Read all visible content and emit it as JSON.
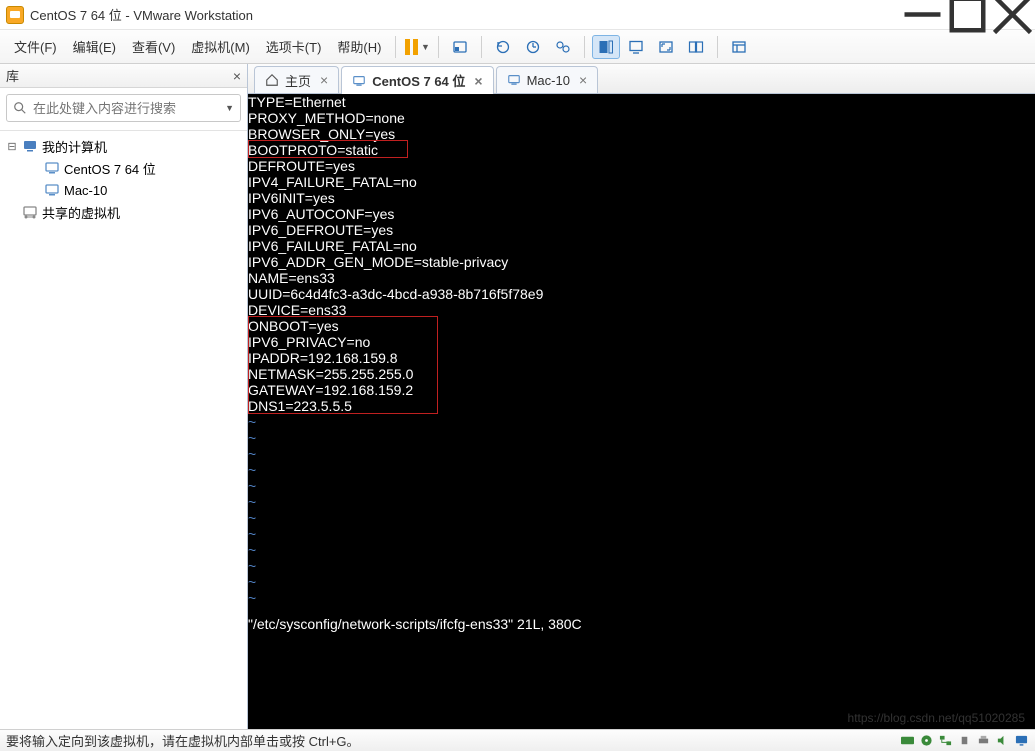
{
  "window": {
    "title": "CentOS 7 64 位 - VMware Workstation"
  },
  "menu": {
    "file": "文件(F)",
    "edit": "编辑(E)",
    "view": "查看(V)",
    "vm": "虚拟机(M)",
    "tabs": "选项卡(T)",
    "help": "帮助(H)"
  },
  "sidebar": {
    "title": "库",
    "search_placeholder": "在此处键入内容进行搜索",
    "nodes": {
      "root": "我的计算机",
      "vm1": "CentOS 7 64 位",
      "vm2": "Mac-10",
      "shared": "共享的虚拟机"
    }
  },
  "tabs": {
    "home": "主页",
    "centos": "CentOS 7 64 位",
    "mac": "Mac-10"
  },
  "terminal": {
    "lines": [
      "TYPE=Ethernet",
      "PROXY_METHOD=none",
      "BROWSER_ONLY=yes",
      "BOOTPROTO=static",
      "DEFROUTE=yes",
      "IPV4_FAILURE_FATAL=no",
      "IPV6INIT=yes",
      "IPV6_AUTOCONF=yes",
      "IPV6_DEFROUTE=yes",
      "IPV6_FAILURE_FATAL=no",
      "IPV6_ADDR_GEN_MODE=stable-privacy",
      "NAME=ens33",
      "UUID=6c4d4fc3-a3dc-4bcd-a938-8b716f5f78e9",
      "DEVICE=ens33",
      "ONBOOT=yes",
      "IPV6_PRIVACY=no",
      "IPADDR=192.168.159.8",
      "NETMASK=255.255.255.0",
      "GATEWAY=192.168.159.2",
      "DNS1=223.5.5.5"
    ],
    "status": "\"/etc/sysconfig/network-scripts/ifcfg-ens33\" 21L, 380C"
  },
  "statusbar": {
    "hint": "要将输入定向到该虚拟机，请在虚拟机内部单击或按 Ctrl+G。"
  }
}
